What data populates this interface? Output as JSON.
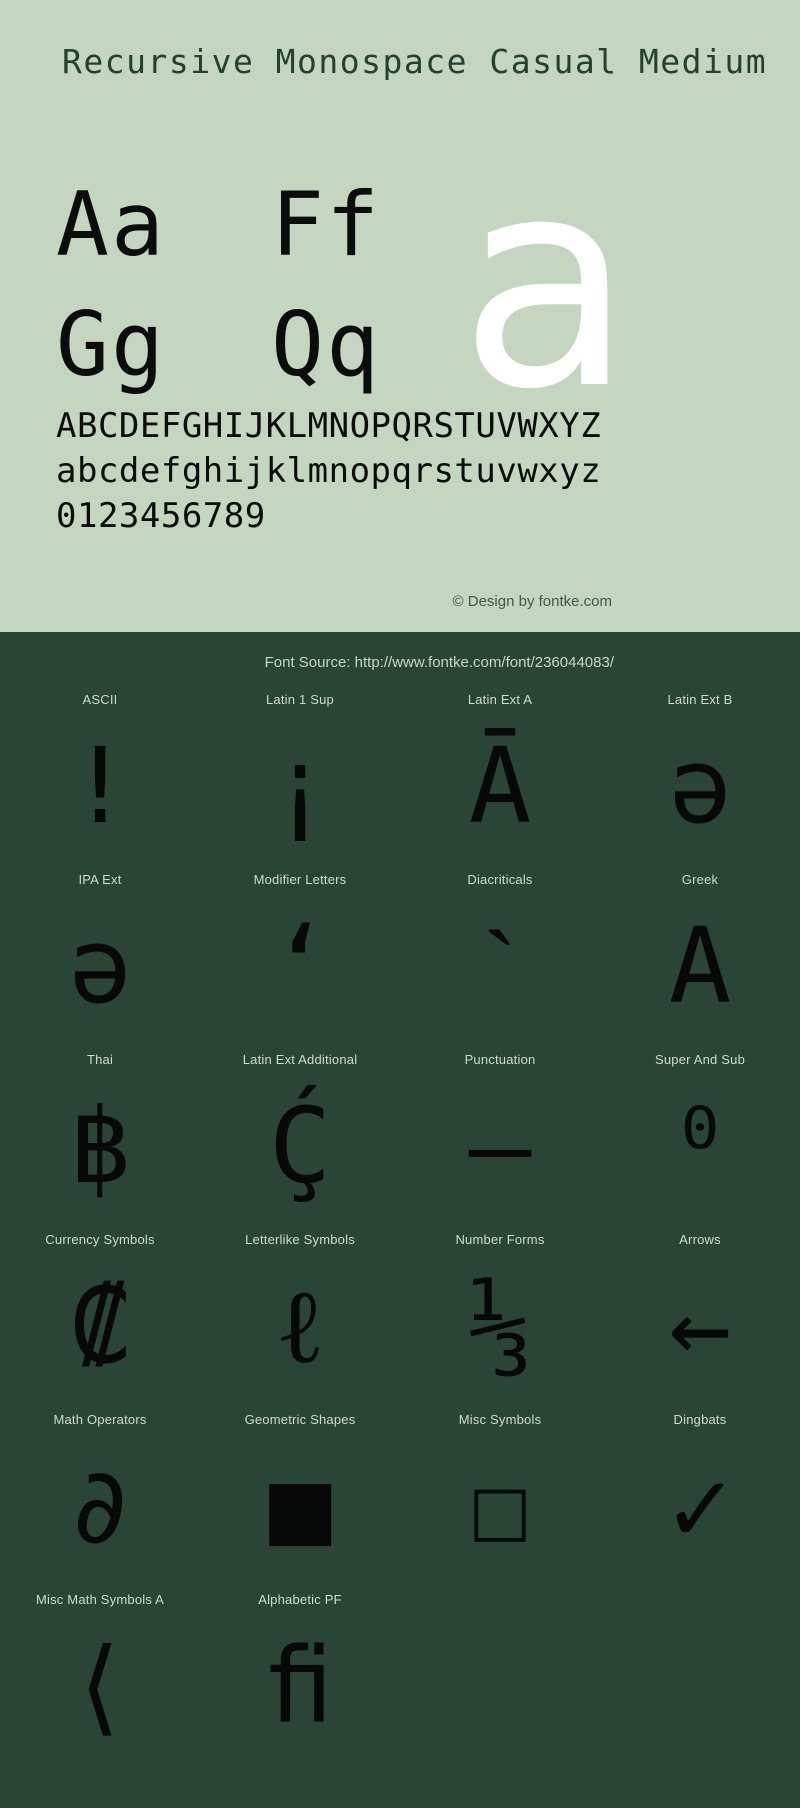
{
  "specimen": {
    "title": "Recursive Monospace Casual Medium",
    "letter_pairs": [
      [
        "Aa",
        "Ff"
      ],
      [
        "Gg",
        "Qq"
      ]
    ],
    "hero_glyph": "a",
    "alphabet_lines": [
      "ABCDEFGHIJKLMNOPQRSTUVWXYZ",
      "abcdefghijklmnopqrstuvwxyz",
      "0123456789"
    ],
    "copyright": "© Design by fontke.com",
    "font_source": "Font Source: http://www.fontke.com/font/236044083/",
    "colors": {
      "top_background": "#c5d6c0",
      "bottom_background": "#2a4435",
      "title_text": "#24402f",
      "glyph_black": "#0b0d0c",
      "hero_white": "#ffffff",
      "label_text": "#cfdccf"
    }
  },
  "unicode_blocks": [
    {
      "label": "ASCII",
      "sample": "!"
    },
    {
      "label": "Latin 1 Sup",
      "sample": "¡"
    },
    {
      "label": "Latin Ext A",
      "sample": "Ā"
    },
    {
      "label": "Latin Ext B",
      "sample": "ǝ"
    },
    {
      "label": "IPA Ext",
      "sample": "ə"
    },
    {
      "label": "Modifier Letters",
      "sample": "ʻ"
    },
    {
      "label": "Diacriticals",
      "sample": "ˋ"
    },
    {
      "label": "Greek",
      "sample": "Α"
    },
    {
      "label": "Thai",
      "sample": "฿"
    },
    {
      "label": "Latin Ext Additional",
      "sample": "Ḉ"
    },
    {
      "label": "Punctuation",
      "sample": "‒"
    },
    {
      "label": "Super And Sub",
      "sample": "⁰"
    },
    {
      "label": "Currency Symbols",
      "sample": "₡"
    },
    {
      "label": "Letterlike Symbols",
      "sample": "ℓ"
    },
    {
      "label": "Number Forms",
      "sample": "⅓"
    },
    {
      "label": "Arrows",
      "sample": "←"
    },
    {
      "label": "Math Operators",
      "sample": "∂"
    },
    {
      "label": "Geometric Shapes",
      "sample": "■"
    },
    {
      "label": "Misc Symbols",
      "sample": "☐"
    },
    {
      "label": "Dingbats",
      "sample": "✓"
    },
    {
      "label": "Misc Math Symbols A",
      "sample": "⟨"
    },
    {
      "label": "Alphabetic PF",
      "sample": "ﬁ"
    }
  ]
}
